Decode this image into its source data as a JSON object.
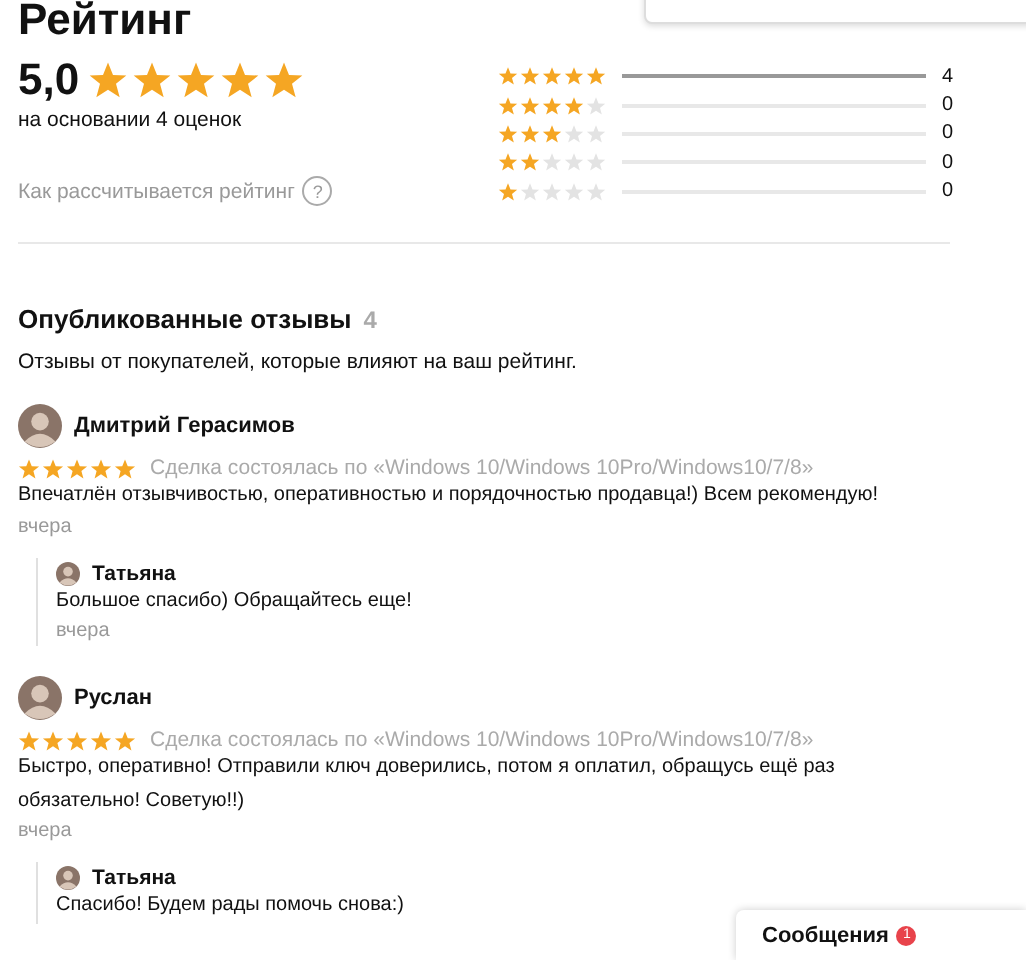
{
  "title": "Рейтинг",
  "summary": {
    "score": "5,0",
    "stars": 5,
    "basis": "на основании 4 оценок"
  },
  "histogram": [
    {
      "stars": 5,
      "level": 1,
      "count": "4"
    },
    {
      "stars": 4,
      "level": 0,
      "count": "0"
    },
    {
      "stars": 3,
      "level": 0,
      "count": "0"
    },
    {
      "stars": 2,
      "level": 0,
      "count": "0"
    },
    {
      "stars": 1,
      "level": 0,
      "count": "0"
    }
  ],
  "help": {
    "label": "Как рассчитывается рейтинг",
    "icon": "?"
  },
  "reviews_section": {
    "title": "Опубликованные отзывы",
    "count": "4",
    "subtitle": "Отзывы от покупателей, которые влияют на ваш рейтинг."
  },
  "reviews": [
    {
      "author": "Дмитрий Герасимов",
      "stars": 5,
      "deal": "Сделка состоялась по «Windows 10/Windows 10Pro/Windows10/7/8»",
      "text": "Впечатлён отзывчивостью, оперативностью и порядочностью продавца!) Всем рекомендую!",
      "date": "вчера",
      "reply": {
        "author": "Татьяна",
        "text": "Большое спасибо) Обращайтесь еще!",
        "date": "вчера"
      }
    },
    {
      "author": "Руслан",
      "stars": 5,
      "deal": "Сделка состоялась по «Windows 10/Windows 10Pro/Windows10/7/8»",
      "text": "Быстро, оперативно! Отправили ключ доверились, потом я оплатил, обращусь ещё раз обязательно! Советую!!)",
      "date": "вчера",
      "reply": {
        "author": "Татьяна",
        "text": "Спасибо! Будем рады помочь снова:)"
      }
    }
  ],
  "messages": {
    "label": "Сообщения",
    "badge": "1"
  }
}
